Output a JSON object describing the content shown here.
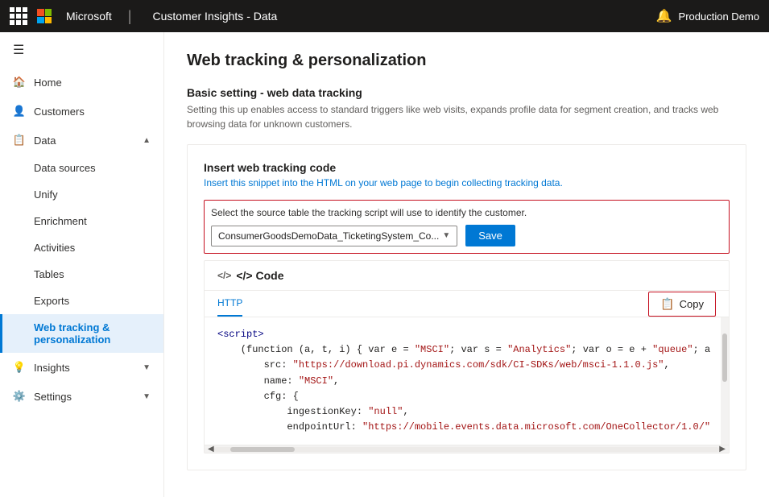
{
  "topNav": {
    "title": "Customer Insights - Data",
    "environment": "Production Demo"
  },
  "sidebar": {
    "hamburger": "☰",
    "items": [
      {
        "id": "home",
        "label": "Home",
        "icon": "home",
        "active": false
      },
      {
        "id": "customers",
        "label": "Customers",
        "icon": "customers",
        "active": false
      },
      {
        "id": "data",
        "label": "Data",
        "icon": "data",
        "expanded": true,
        "active": false,
        "children": [
          {
            "id": "data-sources",
            "label": "Data sources",
            "active": false
          },
          {
            "id": "unify",
            "label": "Unify",
            "active": false
          },
          {
            "id": "enrichment",
            "label": "Enrichment",
            "active": false
          },
          {
            "id": "activities",
            "label": "Activities",
            "active": false
          },
          {
            "id": "tables",
            "label": "Tables",
            "active": false
          },
          {
            "id": "exports",
            "label": "Exports",
            "active": false
          },
          {
            "id": "web-tracking",
            "label": "Web tracking & personalization",
            "active": true
          }
        ]
      },
      {
        "id": "insights",
        "label": "Insights",
        "icon": "insights",
        "active": false
      },
      {
        "id": "settings",
        "label": "Settings",
        "icon": "settings",
        "active": false
      }
    ]
  },
  "page": {
    "title": "Web tracking & personalization",
    "basicSetting": {
      "title": "Basic setting - web data tracking",
      "description": "Setting this up enables access to standard triggers like web visits, expands profile data for segment creation, and tracks web browsing data for unknown customers."
    },
    "codeCard": {
      "title": "Insert web tracking code",
      "linkText": "Insert this snippet into the HTML on your web page to begin collecting tracking data.",
      "selectLabel": "Select the source table the tracking script will use to identify the customer.",
      "selectValue": "ConsumerGoodsDemoData_TicketingSystem_Co...",
      "saveLabel": "Save",
      "codeTabLabel": "</> Code",
      "httpTab": "HTTP",
      "copyLabel": "Copy",
      "codeLines": [
        "<script>",
        "    (function (a, t, i) { var e = \"MSCI\"; var s = \"Analytics\"; var o = e + \"queue\"; a",
        "",
        "        src: \"https://download.pi.dynamics.com/sdk/CI-SDKs/web/msci-1.1.0.js\",",
        "        name: \"MSCI\",",
        "        cfg: {",
        "",
        "            ingestionKey: \"null\",",
        "            endpointUrl: \"https://mobile.events.data.microsoft.com/OneCollector/1.0/\""
      ]
    }
  }
}
